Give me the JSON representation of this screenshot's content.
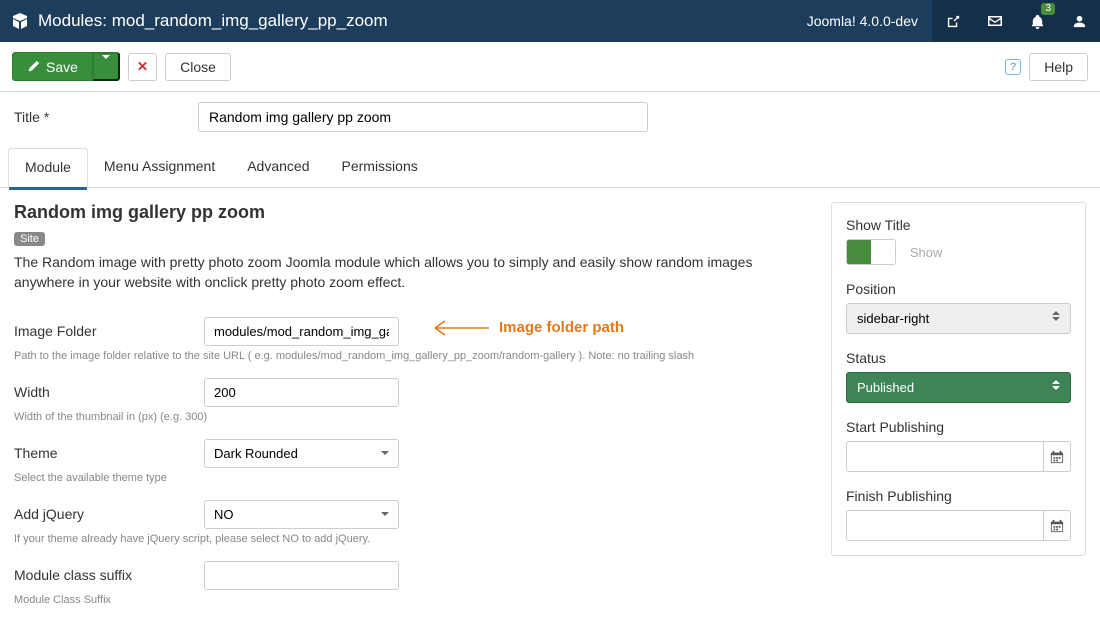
{
  "topbar": {
    "title": "Modules: mod_random_img_gallery_pp_zoom",
    "version": "Joomla! 4.0.0-dev",
    "notif_count": "3"
  },
  "toolbar": {
    "save": "Save",
    "close": "Close",
    "help": "Help"
  },
  "title_row": {
    "label": "Title *",
    "value": "Random img gallery pp zoom"
  },
  "tabs": {
    "module": "Module",
    "menu": "Menu Assignment",
    "advanced": "Advanced",
    "permissions": "Permissions"
  },
  "module": {
    "heading": "Random img gallery pp zoom",
    "site_badge": "Site",
    "description": "The Random image with pretty photo zoom Joomla module which allows you to simply and easily show random images anywhere in your website with onclick pretty photo zoom effect.",
    "fields": {
      "image_folder": {
        "label": "Image Folder",
        "value": "modules/mod_random_img_gallery",
        "help": "Path to the image folder relative to the site URL ( e.g. modules/mod_random_img_gallery_pp_zoom/random-gallery ). Note: no trailing slash"
      },
      "width": {
        "label": "Width",
        "value": "200",
        "help": "Width of the thumbnail in (px) (e.g. 300)"
      },
      "theme": {
        "label": "Theme",
        "value": "Dark Rounded",
        "help": "Select the available theme type"
      },
      "jquery": {
        "label": "Add jQuery",
        "value": "NO",
        "help": "If your theme already have jQuery script, please select NO to add jQuery."
      },
      "suffix": {
        "label": "Module class suffix",
        "value": "",
        "help": "Module Class Suffix"
      }
    },
    "annotation": "Image folder path"
  },
  "sidebar": {
    "show_title": {
      "label": "Show Title",
      "text": "Show"
    },
    "position": {
      "label": "Position",
      "value": "sidebar-right"
    },
    "status": {
      "label": "Status",
      "value": "Published"
    },
    "start": {
      "label": "Start Publishing"
    },
    "finish": {
      "label": "Finish Publishing"
    }
  }
}
